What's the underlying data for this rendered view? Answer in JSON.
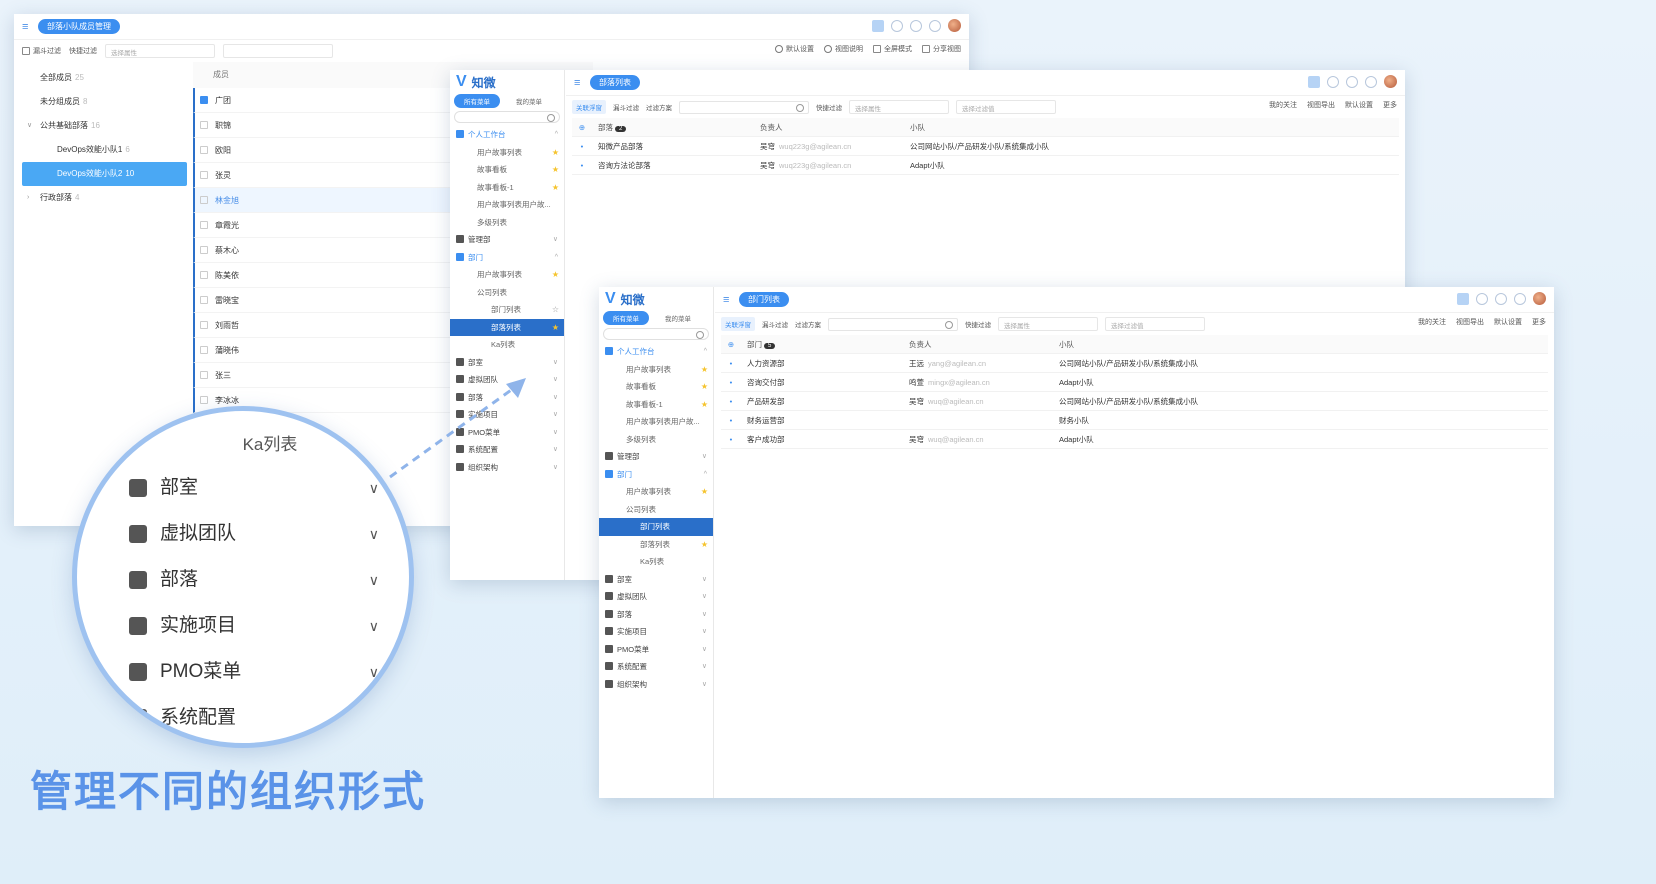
{
  "headline": "管理不同的组织形式",
  "colors": {
    "accent": "#3b8ef0",
    "selected": "#2a6fc9",
    "star": "#f5c32c"
  },
  "w1": {
    "title": "部落小队成员管理",
    "tb_filter": "漏斗过滤",
    "tb_quick": "快捷过滤",
    "tb_attr_placeholder": "选择属性",
    "tb_right": [
      "默认设置",
      "视图说明",
      "全屏模式",
      "分享视图"
    ],
    "groups": [
      {
        "label": "全部成员",
        "count": "25"
      },
      {
        "label": "未分组成员",
        "count": "8"
      },
      {
        "label": "公共基础部落",
        "count": "16"
      },
      {
        "label": "DevOps效能小队1",
        "count": "6"
      },
      {
        "label": "DevOps效能小队2",
        "count": "10"
      },
      {
        "label": "行政部落",
        "count": "4"
      }
    ],
    "list_header": "成员",
    "members": [
      "广团",
      "职锦",
      "欧阳",
      "张灵",
      "林金旭",
      "章霞光",
      "蔡木心",
      "陈美依",
      "雷晓宝",
      "刘雨哲",
      "蒲晓伟",
      "张三",
      "李冰冰"
    ]
  },
  "app": {
    "logo": "知微",
    "tab_all": "所有菜单",
    "tab_mine": "我的菜单",
    "personal": "个人工作台",
    "personal_items": [
      "用户故事列表",
      "故事看板",
      "故事看板-1",
      "用户故事列表用户故...",
      "多级列表"
    ],
    "mgmt": "管理部",
    "dept": "部门",
    "dept_items": [
      "用户故事列表",
      "公司列表"
    ],
    "dept_sub": [
      "部门列表",
      "部落列表",
      "Ka列表"
    ],
    "others": [
      "部室",
      "虚拟团队",
      "部落",
      "实施项目",
      "PMO菜单",
      "系统配置",
      "组织架构"
    ],
    "tb_link": "关联浮窗",
    "tb_funnel": "漏斗过滤",
    "tb_scheme": "过滤方案",
    "tb_quick": "快捷过滤",
    "attr_ph": "选择属性",
    "val_ph": "选择过滤值",
    "tb_right": [
      "我的关注",
      "视图导出",
      "默认设置",
      "更多"
    ],
    "col_owner": "负责人",
    "col_team": "小队"
  },
  "w2": {
    "title": "部落列表",
    "col1": "部落",
    "count": "2",
    "personal_items": [
      "用户故事列表",
      "故事看板",
      "故事看板-1",
      "用户故事列表用户故...",
      "多级列表"
    ],
    "rows": [
      {
        "name": "知微产品部落",
        "owner": "吴穹",
        "email": "wuq223g@agilean.cn",
        "team": "公司网站小队/产品研发小队/系统集成小队"
      },
      {
        "name": "咨询方法论部落",
        "owner": "吴穹",
        "email": "wuq223g@agilean.cn",
        "team": "Adapt小队"
      }
    ]
  },
  "w3": {
    "title": "部门列表",
    "col1": "部门",
    "count": "5",
    "personal_items": [
      "用户故事列表",
      "故事看板",
      "故事看板-1",
      "用户故事列表用户故...",
      "多级列表"
    ],
    "rows": [
      {
        "name": "人力资源部",
        "owner": "王远",
        "email": "yang@agilean.cn",
        "team": "公司网站小队/产品研发小队/系统集成小队"
      },
      {
        "name": "咨询交付部",
        "owner": "鸣萱",
        "email": "mingx@agilean.cn",
        "team": "Adapt小队"
      },
      {
        "name": "产品研发部",
        "owner": "吴穹",
        "email": "wuq@agilean.cn",
        "team": "公司网站小队/产品研发小队/系统集成小队"
      },
      {
        "name": "财务运营部",
        "owner": "",
        "email": "",
        "team": "财务小队"
      },
      {
        "name": "客户成功部",
        "owner": "吴穹",
        "email": "wuq@agilean.cn",
        "team": "Adapt小队"
      }
    ]
  },
  "mag": {
    "title": "Ka列表",
    "items": [
      "部室",
      "虚拟团队",
      "部落",
      "实施项目",
      "PMO菜单",
      "系统配置"
    ]
  }
}
